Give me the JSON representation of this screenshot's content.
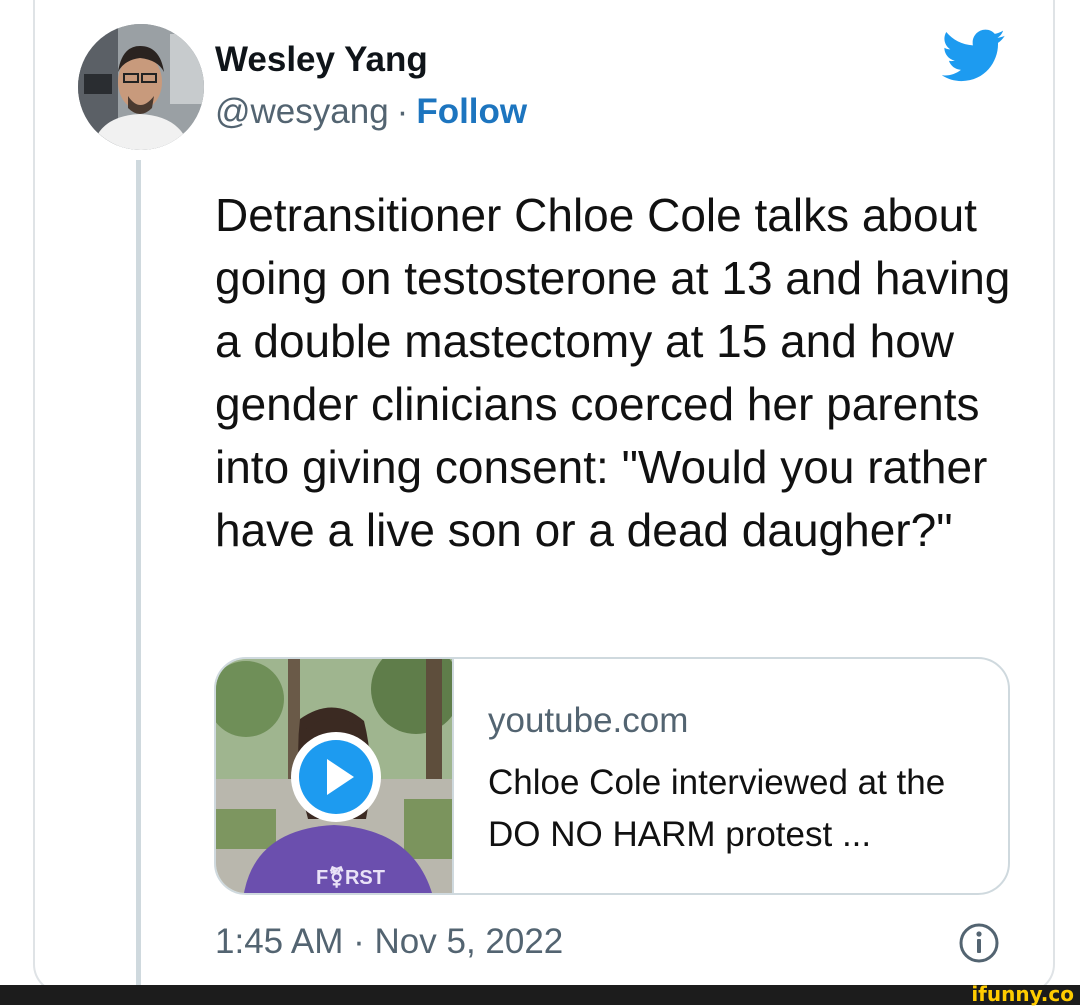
{
  "tweet": {
    "author_name": "Wesley Yang",
    "handle": "@wesyang",
    "separator": "·",
    "follow_label": "Follow",
    "text": "Detransitioner Chloe Cole talks about going on testosterone at 13 and having a double mastectomy at 15 and how gender clinicians coerced her parents into giving consent: \"Would you rather have a live son or a dead daugher?\"",
    "timestamp": "1:45 AM · Nov 5, 2022"
  },
  "link_card": {
    "domain": "youtube.com",
    "title": "Chloe Cole interviewed at the DO NO HARM protest ...",
    "thumbnail_shirt_text": "F⚧RST"
  },
  "icons": {
    "brand": "twitter-bird-icon",
    "play": "play-icon",
    "info": "info-icon"
  },
  "colors": {
    "twitter_blue": "#1d9bf0",
    "follow_blue": "#1d75bf",
    "secondary_text": "#536471",
    "border": "#cfd9de"
  },
  "watermark": "ifunny.co"
}
